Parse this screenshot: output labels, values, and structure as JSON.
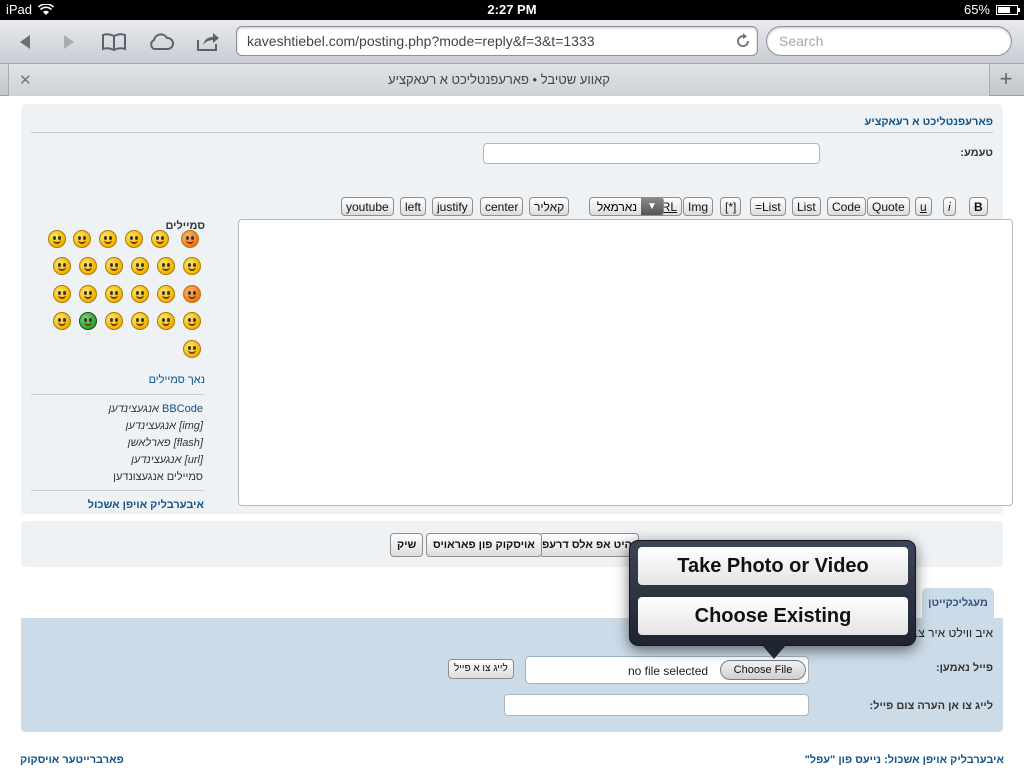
{
  "status": {
    "device": "iPad",
    "time": "2:27 PM",
    "battery": "65%",
    "battery_level": 0.65
  },
  "browser": {
    "url": "kaveshtiebel.com/posting.php?mode=reply&f=3&t=1333",
    "search_placeholder": "Search",
    "tab_title": "קאווע שטיבל • פארעפנטליכט א רעאקציע"
  },
  "page": {
    "breadcrumb": "פארעפנטליכט א רעאקציע",
    "subject_label": "טעמע:",
    "bbcode_buttons": [
      "B",
      "i",
      "u",
      "Quote",
      "Code",
      "List",
      "=List",
      "[*]",
      "Img",
      "URL",
      "נארמאל",
      "קאליר",
      "center",
      "justify",
      "left",
      "youtube"
    ],
    "smilies_title": "סמיילים",
    "more_smilies": "נאך סמיילים",
    "help_lines": {
      "bbcode_name": "BBCode",
      "bbcode": "אנגעצינדען",
      "img": "[img] אנגעצינדען",
      "flash": "[flash] פארלאשן",
      "url": "[url] אנגעצינדען",
      "smilies": "סמיילים אנגעצונדען"
    },
    "expand_view": "איבערבליק אויפן אשכול",
    "buttons": {
      "save_draft": "היט אפ אלס דרעפט",
      "preview": "אויסקוק פון פאראויס",
      "submit": "שיק"
    },
    "attach_tab": "מעגליכקייטן",
    "attach_info": "איב ווילט איר צ... טאלן.",
    "filename_label": "פייל נאמען:",
    "no_file": "no file selected",
    "choose_file": "Choose File",
    "add_file": "לייג צו א פייל",
    "comment_label": "לייג צו אן הערה צום פייל:",
    "footer_right": "איבערבליק אויפן אשכול: נייעס פון \"עפל\"",
    "footer_left": "פארברייטער אויסקוק"
  },
  "popover": {
    "take_photo": "Take Photo or Video",
    "choose_existing": "Choose Existing"
  }
}
